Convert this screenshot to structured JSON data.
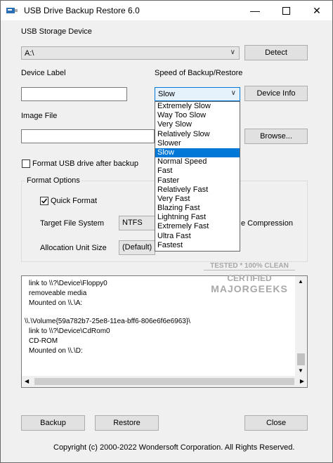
{
  "window": {
    "title": "USB Drive Backup Restore 6.0"
  },
  "usb": {
    "label": "USB Storage Device",
    "drive": "A:\\",
    "detect_button": "Detect"
  },
  "device_label": {
    "label": "Device Label",
    "value": ""
  },
  "speed": {
    "label": "Speed of Backup/Restore",
    "selected": "Slow",
    "device_info_button": "Device Info",
    "options": [
      "Extremely Slow",
      "Way Too Slow",
      "Very Slow",
      "Relatively Slow",
      "Slower",
      "Slow",
      "Normal Speed",
      "Fast",
      "Faster",
      "Relatively Fast",
      "Very Fast",
      "Blazing Fast",
      "Lightning Fast",
      "Extremely Fast",
      "Ultra Fast",
      "Fastest"
    ]
  },
  "image_file": {
    "label": "Image File",
    "value": "",
    "browse_button": "Browse..."
  },
  "format_after_backup": {
    "label": "Format USB drive after backup",
    "checked": false
  },
  "format_options": {
    "title": "Format Options",
    "quick_format": {
      "label": "Quick Format",
      "checked": true
    },
    "target_fs": {
      "label": "Target File System",
      "value": "NTFS"
    },
    "compression_label": "e Compression",
    "alloc_unit": {
      "label": "Allocation Unit Size",
      "value": "(Default)"
    }
  },
  "log": {
    "lines": [
      "link to \\\\?\\Device\\Floppy0",
      "removeable media",
      "Mounted on \\\\.\\A:",
      "",
      "\\\\.\\Volume{59a782b7-25e8-11ea-bff6-806e6f6e6963}\\",
      "link to \\\\?\\Device\\CdRom0",
      "CD-ROM",
      "Mounted on \\\\.\\D:"
    ]
  },
  "buttons": {
    "backup": "Backup",
    "restore": "Restore",
    "close": "Close"
  },
  "copyright": "Copyright (c) 2000-2022 Wondersoft Corporation. All Rights Reserved.",
  "watermark": {
    "line1": "TESTED * 100% CLEAN",
    "line2": "CERTIFIED",
    "line3": "MAJORGEEKS"
  },
  "colors": {
    "selection": "#0078d7",
    "window_bg": "#f0f0f0"
  }
}
